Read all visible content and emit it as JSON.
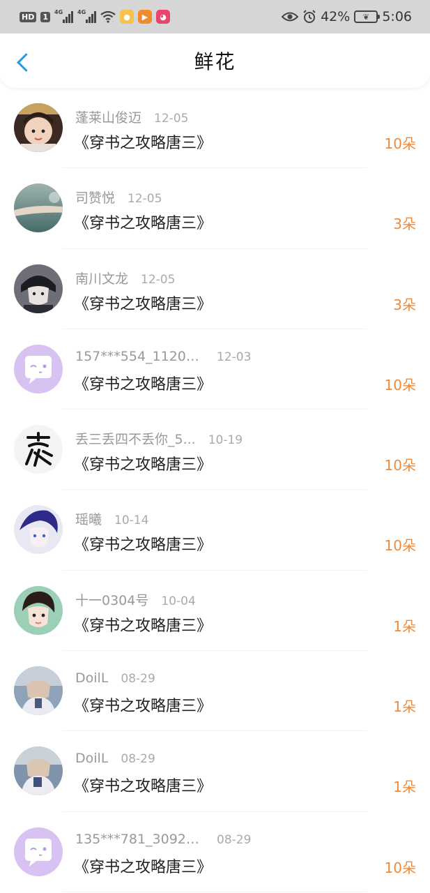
{
  "status_bar": {
    "hd": "HD",
    "sim": "1",
    "signal_tag": "4G",
    "battery": "42%",
    "time": "5:06"
  },
  "header": {
    "title": "鲜花",
    "back_icon": "chevron-left-icon"
  },
  "colors": {
    "accent": "#1e9be9",
    "count": "#ee8a3c",
    "name": "#999999"
  },
  "items": [
    {
      "name": "蓬莱山俊迈",
      "date": "12-05",
      "book": "《穿书之攻略唐三》",
      "count": "10朵",
      "avatar": "photo-avatar"
    },
    {
      "name": "司赞悦",
      "date": "12-05",
      "book": "《穿书之攻略唐三》",
      "count": "3朵",
      "avatar": "photo-avatar"
    },
    {
      "name": "南川文龙",
      "date": "12-05",
      "book": "《穿书之攻略唐三》",
      "count": "3朵",
      "avatar": "photo-avatar"
    },
    {
      "name": "157***554_11209...",
      "date": "12-03",
      "book": "《穿书之攻略唐三》",
      "count": "10朵",
      "avatar": "default-avatar"
    },
    {
      "name": "丢三丢四不丢你_5...",
      "date": "10-19",
      "book": "《穿书之攻略唐三》",
      "count": "10朵",
      "avatar": "calligraphy-avatar"
    },
    {
      "name": "瑶曦",
      "date": "10-14",
      "book": "《穿书之攻略唐三》",
      "count": "10朵",
      "avatar": "photo-avatar"
    },
    {
      "name": "十一0304号",
      "date": "10-04",
      "book": "《穿书之攻略唐三》",
      "count": "1朵",
      "avatar": "photo-avatar"
    },
    {
      "name": "DoilL",
      "date": "08-29",
      "book": "《穿书之攻略唐三》",
      "count": "1朵",
      "avatar": "photo-avatar"
    },
    {
      "name": "DoilL",
      "date": "08-29",
      "book": "《穿书之攻略唐三》",
      "count": "1朵",
      "avatar": "photo-avatar"
    },
    {
      "name": "135***781_30929...",
      "date": "08-29",
      "book": "《穿书之攻略唐三》",
      "count": "10朵",
      "avatar": "default-avatar"
    }
  ]
}
